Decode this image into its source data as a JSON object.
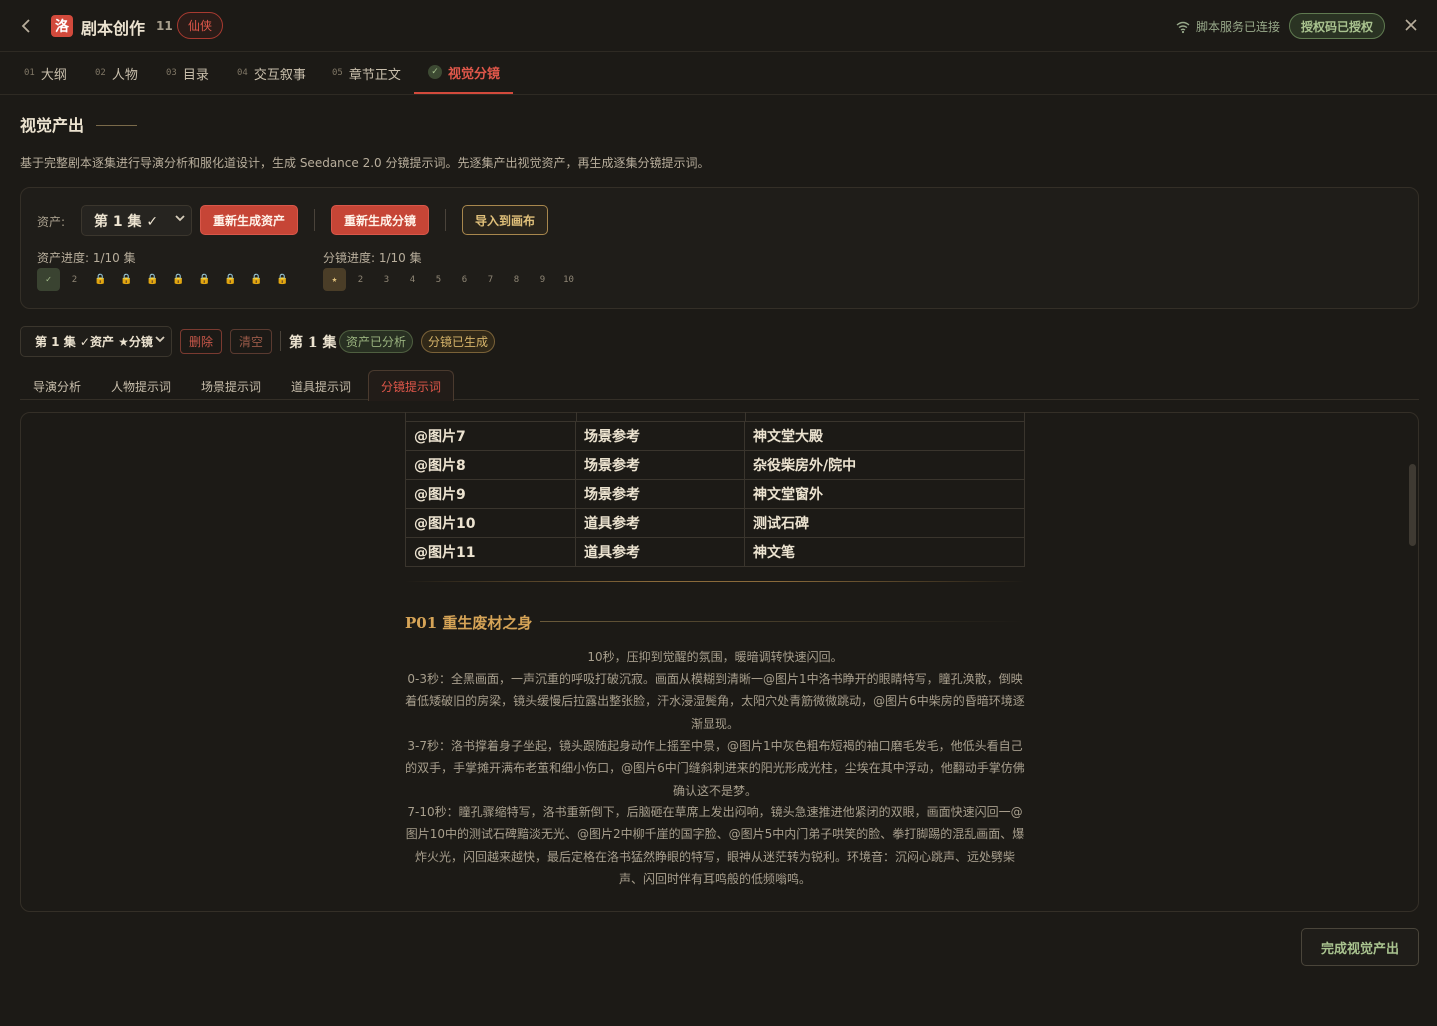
{
  "header": {
    "logo_char": "洛",
    "title": "剧本创作",
    "count": "11",
    "genre": "仙侠",
    "connection": "脚本服务已连接",
    "auth": "授权码已授权"
  },
  "steps": [
    {
      "num": "01",
      "label": "大纲"
    },
    {
      "num": "02",
      "label": "人物"
    },
    {
      "num": "03",
      "label": "目录"
    },
    {
      "num": "04",
      "label": "交互叙事"
    },
    {
      "num": "05",
      "label": "章节正文"
    },
    {
      "num": "✓",
      "label": "视觉分镜"
    }
  ],
  "section": {
    "title": "视觉产出",
    "description": "基于完整剧本逐集进行导演分析和服化道设计，生成 Seedance 2.0 分镜提示词。先逐集产出视觉资产，再生成逐集分镜提示词。"
  },
  "controls": {
    "asset_label": "资产:",
    "episode_select": "第 1 集 ✓",
    "regen_assets": "重新生成资产",
    "regen_storyboard": "重新生成分镜",
    "import_canvas": "导入到画布",
    "asset_progress_label": "资产进度: 1/10 集",
    "storyboard_progress_label": "分镜进度: 1/10 集",
    "asset_chips": [
      "✓",
      "2",
      "🔒",
      "🔒",
      "🔒",
      "🔒",
      "🔒",
      "🔒",
      "🔒",
      "🔒"
    ],
    "storyboard_chips": [
      "★",
      "2",
      "3",
      "4",
      "5",
      "6",
      "7",
      "8",
      "9",
      "10"
    ]
  },
  "episode_bar": {
    "select": "第 1 集 ✓资产 ★分镜",
    "delete": "删除",
    "clear": "清空",
    "title": "第 1 集",
    "badge_assets": "资产已分析",
    "badge_storyboard": "分镜已生成"
  },
  "subtabs": [
    "导演分析",
    "人物提示词",
    "场景提示词",
    "道具提示词",
    "分镜提示词"
  ],
  "table": [
    [
      "@图片7",
      "场景参考",
      "神文堂大殿"
    ],
    [
      "@图片8",
      "场景参考",
      "杂役柴房外/院中"
    ],
    [
      "@图片9",
      "场景参考",
      "神文堂窗外"
    ],
    [
      "@图片10",
      "道具参考",
      "测试石碑"
    ],
    [
      "@图片11",
      "道具参考",
      "神文笔"
    ]
  ],
  "scene": {
    "title": "P01 重生废材之身",
    "lines": [
      "10秒，压抑到觉醒的氛围，暖暗调转快速闪回。",
      "0-3秒：全黑画面，一声沉重的呼吸打破沉寂。画面从模糊到清晰一@图片1中洛书睁开的眼睛特写，瞳孔涣散，倒映着低矮破旧的房梁，镜头缓慢后拉露出整张脸，汗水浸湿鬓角，太阳穴处青筋微微跳动，@图片6中柴房的昏暗环境逐渐显现。",
      "3-7秒：洛书撑着身子坐起，镜头跟随起身动作上摇至中景，@图片1中灰色粗布短褐的袖口磨毛发毛，他低头看自己的双手，手掌摊开满布老茧和细小伤口，@图片6中门缝斜刺进来的阳光形成光柱，尘埃在其中浮动，他翻动手掌仿佛确认这不是梦。",
      "7-10秒：瞳孔骤缩特写，洛书重新倒下，后脑砸在草席上发出闷响，镜头急速推进他紧闭的双眼，画面快速闪回一@图片10中的测试石碑黯淡无光、@图片2中柳千崖的国字脸、@图片5中内门弟子哄笑的脸、拳打脚踢的混乱画面、爆炸火光，闪回越来越快，最后定格在洛书猛然睁眼的特写，眼神从迷茫转为锐利。环境音：沉闷心跳声、远处劈柴声、闪回时伴有耳鸣般的低频嗡鸣。"
    ]
  },
  "finish_button": "完成视觉产出"
}
